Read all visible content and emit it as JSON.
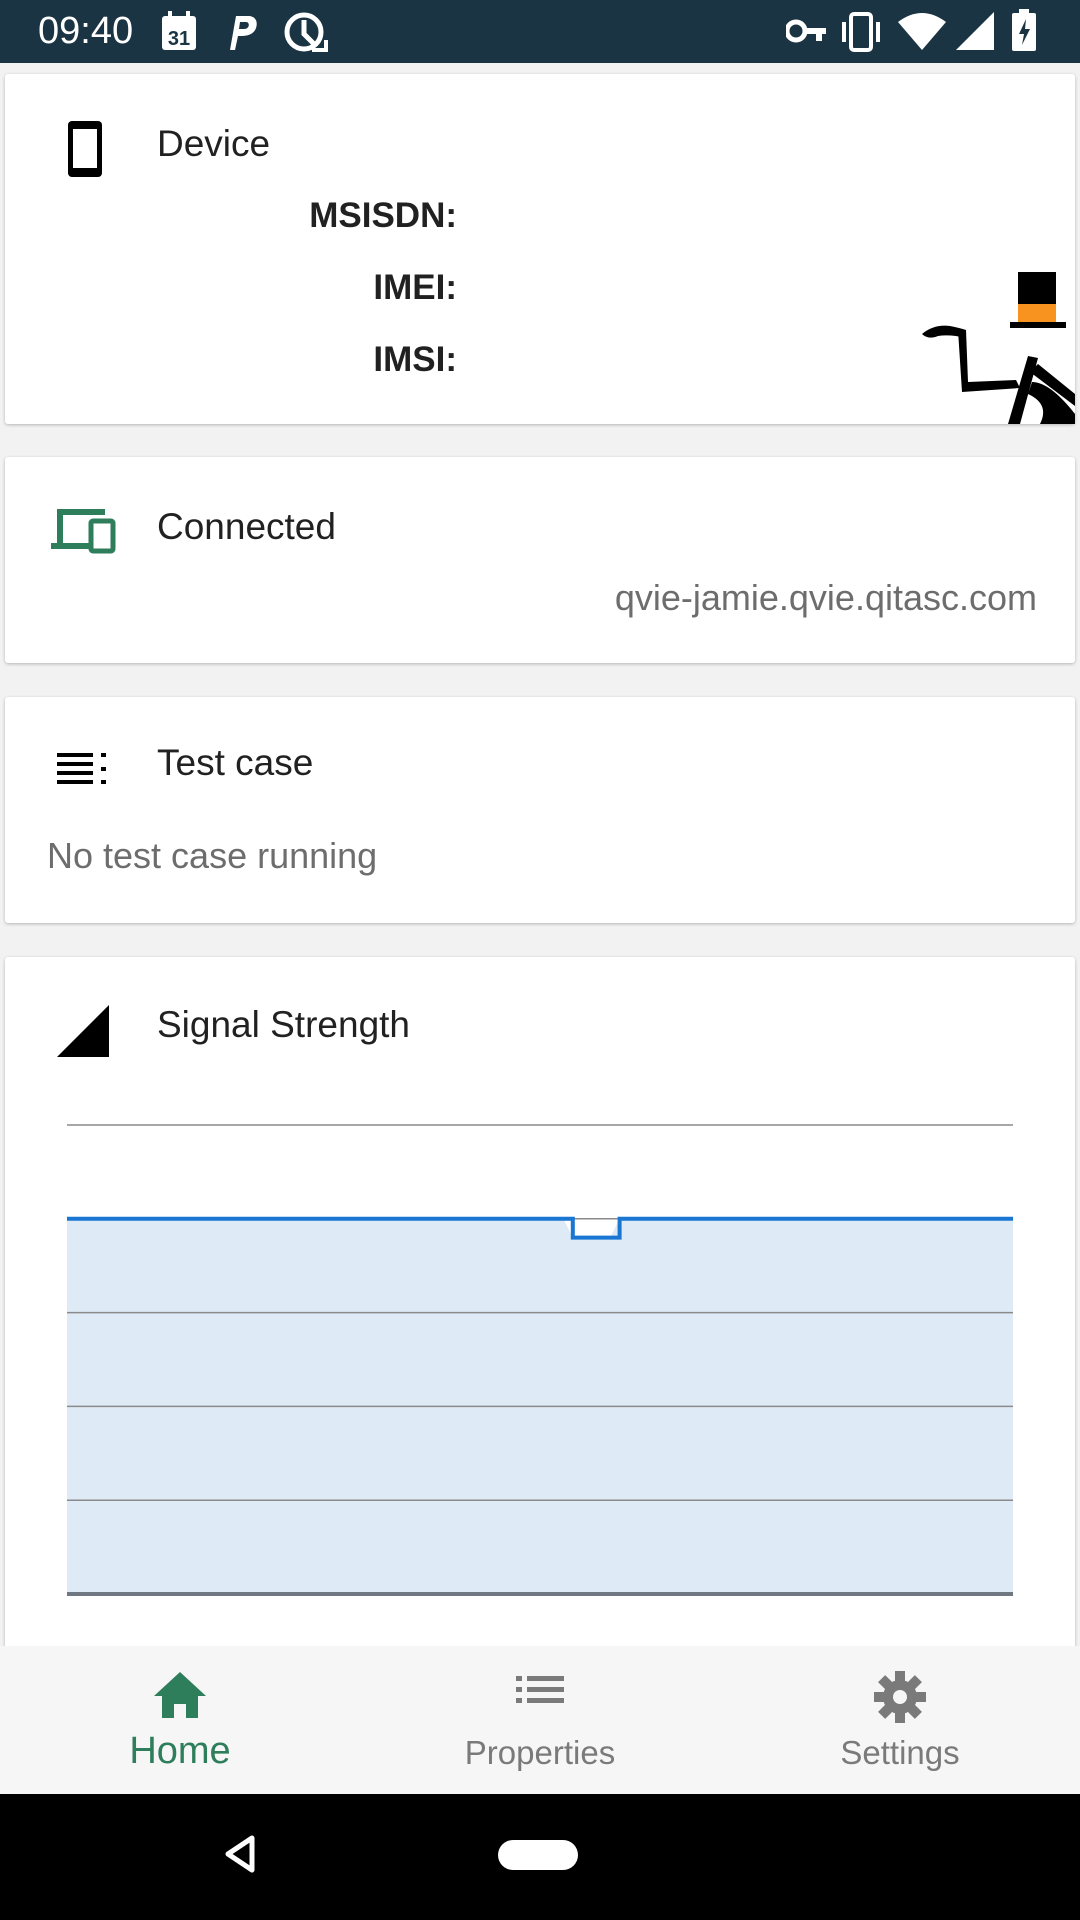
{
  "status_bar": {
    "time": "09:40",
    "calendar_day": "31",
    "left_icons": [
      "calendar-icon",
      "parking-app-icon",
      "sync-icon"
    ],
    "right_icons": [
      "vpn-key-icon",
      "vibrate-icon",
      "wifi-icon",
      "cell-signal-icon",
      "battery-charging-icon"
    ]
  },
  "device_card": {
    "icon": "phone-icon",
    "title": "Device",
    "fields": [
      {
        "label": "MSISDN:",
        "value": ""
      },
      {
        "label": "IMEI:",
        "value": ""
      },
      {
        "label": "IMSI:",
        "value": ""
      }
    ],
    "mascot": "top-hat-mascot"
  },
  "connection_card": {
    "icon": "devices-icon",
    "title": "Connected",
    "host": "qvie-jamie.qvie.qitasc.com",
    "accent": "#2e7d5b"
  },
  "testcase_card": {
    "icon": "list-icon",
    "title": "Test case",
    "status": "No test case running"
  },
  "signal_card": {
    "icon": "signal-icon",
    "title": "Signal Strength"
  },
  "chart_data": {
    "type": "area",
    "ylim": [
      0,
      5
    ],
    "grid": true,
    "series": [
      {
        "values": [
          4,
          4,
          4,
          4,
          4,
          4,
          4,
          4,
          4,
          4,
          4,
          4,
          4,
          4,
          4,
          4,
          4,
          4,
          4,
          4,
          4,
          4,
          4,
          4,
          4,
          4,
          4,
          4,
          4,
          4,
          4,
          4,
          4,
          4,
          4,
          4,
          4,
          4,
          4,
          4,
          4,
          4,
          4,
          4,
          4,
          4,
          4,
          4,
          4,
          4,
          4,
          4,
          4,
          4,
          3.8,
          3.8,
          3.8,
          3.8,
          3.8,
          4,
          4,
          4,
          4,
          4,
          4,
          4,
          4,
          4,
          4,
          4,
          4,
          4,
          4,
          4,
          4,
          4,
          4,
          4,
          4,
          4,
          4,
          4,
          4,
          4,
          4,
          4,
          4,
          4,
          4,
          4,
          4,
          4,
          4,
          4,
          4,
          4,
          4,
          4,
          4,
          4,
          4,
          4
        ],
        "color": "#1976d2",
        "fill": "#deebf7"
      }
    ]
  },
  "bottom_nav": {
    "items": [
      {
        "label": "Home",
        "icon": "home-icon",
        "active": true
      },
      {
        "label": "Properties",
        "icon": "list-icon",
        "active": false
      },
      {
        "label": "Settings",
        "icon": "gear-icon",
        "active": false
      }
    ],
    "active_color": "#2e7d5b",
    "inactive_color": "#7a7a7a"
  }
}
